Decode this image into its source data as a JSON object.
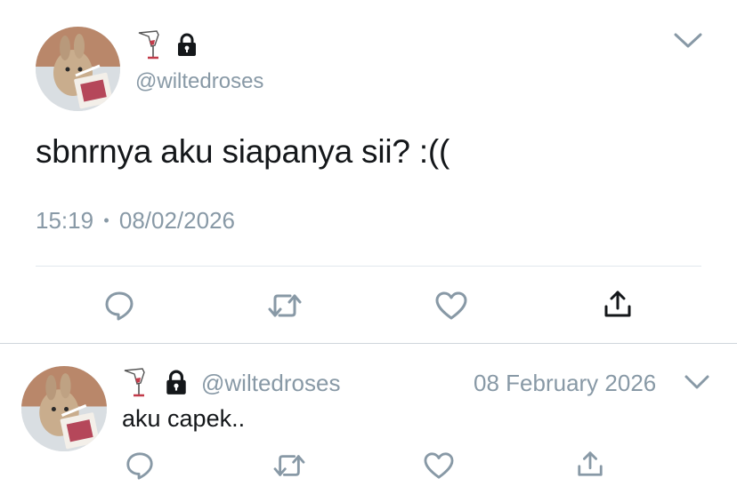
{
  "colors": {
    "icon_gray": "#8899a6",
    "text": "#14171a",
    "divider": "#e1e8ed"
  },
  "main_tweet": {
    "avatar": "bunny-avatar",
    "name_icons": [
      "wine-glass-icon",
      "lock-icon"
    ],
    "handle": "@wiltedroses",
    "text": "sbnrnya aku siapanya sii? :((",
    "time": "15:19",
    "separator": "•",
    "date": "08/02/2026",
    "actions": [
      "reply-icon",
      "retweet-icon",
      "like-icon",
      "share-icon"
    ],
    "menu_icon": "chevron-down-icon"
  },
  "reply_tweet": {
    "avatar": "bunny-avatar",
    "name_icons": [
      "wine-glass-icon",
      "lock-icon"
    ],
    "handle": "@wiltedroses",
    "date": "08 February 2026",
    "text": "aku capek..",
    "actions": [
      "reply-icon",
      "retweet-icon",
      "like-icon",
      "share-icon"
    ],
    "menu_icon": "chevron-down-icon"
  }
}
